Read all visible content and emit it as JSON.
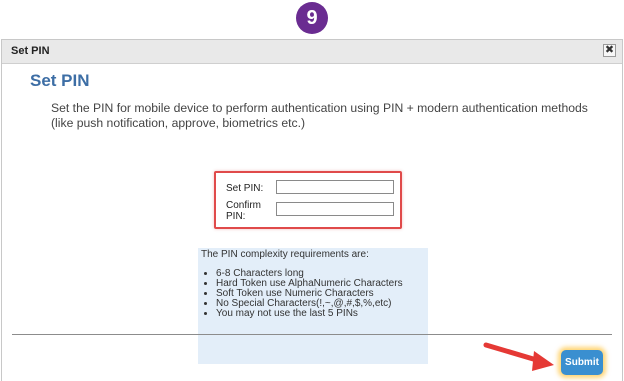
{
  "step_badge": "9",
  "dialog": {
    "title": "Set PIN",
    "close_symbol": "✖",
    "heading": "Set PIN",
    "description": "Set the PIN for mobile device to perform authentication using PIN + modern authentication methods (like push notification, approve, biometrics etc.)"
  },
  "form": {
    "set_pin_label": "Set PIN:",
    "confirm_pin_label": "Confirm PIN:",
    "set_pin_value": "",
    "confirm_pin_value": ""
  },
  "requirements": {
    "title": "The PIN complexity requirements are:",
    "items": [
      "6-8 Characters long",
      "Hard Token use AlphaNumeric Characters",
      "Soft Token use Numeric Characters",
      "No Special Characters(!,~,@,#,$,%,etc)",
      "You may not use the last 5 PINs"
    ]
  },
  "actions": {
    "submit_label": "Submit"
  },
  "colors": {
    "badge": "#6a2c91",
    "heading": "#3d6ea5",
    "highlight_border": "#e04a4a",
    "requirements_bg": "#e3eef9",
    "submit_bg": "#3a8fd0",
    "arrow": "#e53935"
  }
}
